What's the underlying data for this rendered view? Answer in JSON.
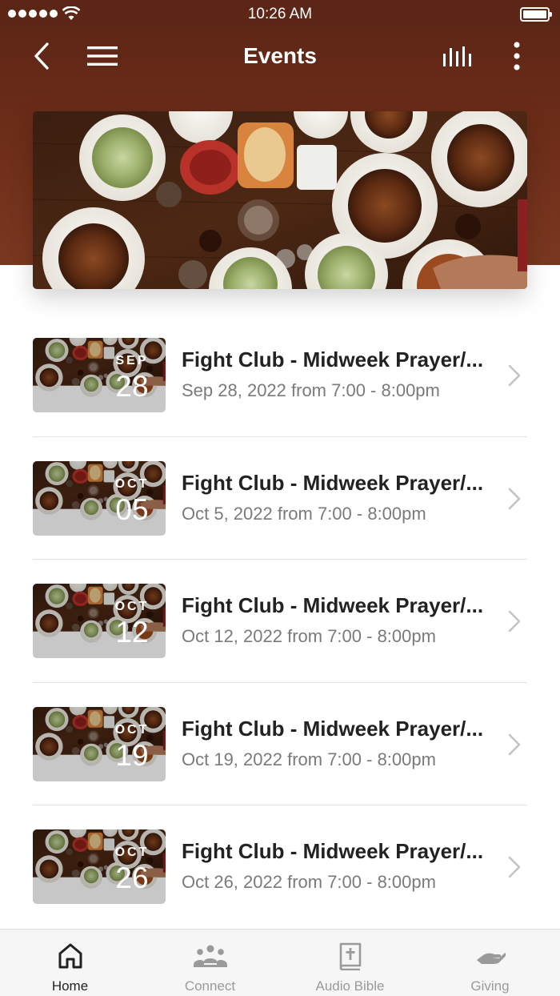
{
  "status_bar": {
    "time": "10:26 AM"
  },
  "nav": {
    "title": "Events",
    "back_icon": "chevron-left-icon",
    "menu_icon": "hamburger-menu-icon",
    "audio_icon": "audio-levels-icon",
    "more_icon": "more-vertical-icon"
  },
  "hero": {
    "image": "food-table-photo"
  },
  "events": [
    {
      "month": "SEP",
      "day": "28",
      "title": "Fight Club - Midweek Prayer/...",
      "date_text": "Sep 28, 2022 from 7:00 - 8:00pm"
    },
    {
      "month": "OCT",
      "day": "05",
      "title": "Fight Club - Midweek Prayer/...",
      "date_text": "Oct 5, 2022 from 7:00 - 8:00pm"
    },
    {
      "month": "OCT",
      "day": "12",
      "title": "Fight Club - Midweek Prayer/...",
      "date_text": "Oct 12, 2022 from 7:00 - 8:00pm"
    },
    {
      "month": "OCT",
      "day": "19",
      "title": "Fight Club - Midweek Prayer/...",
      "date_text": "Oct 19, 2022 from 7:00 - 8:00pm"
    },
    {
      "month": "OCT",
      "day": "26",
      "title": "Fight Club - Midweek Prayer/...",
      "date_text": "Oct 26, 2022 from 7:00 - 8:00pm"
    }
  ],
  "tabs": [
    {
      "label": "Home",
      "icon": "home-icon",
      "active": true
    },
    {
      "label": "Connect",
      "icon": "group-icon",
      "active": false
    },
    {
      "label": "Audio Bible",
      "icon": "bible-icon",
      "active": false
    },
    {
      "label": "Giving",
      "icon": "giving-hand-icon",
      "active": false
    }
  ],
  "colors": {
    "header": "#6b2c18",
    "tab_active": "#222222",
    "tab_inactive": "#9a9a9a"
  }
}
